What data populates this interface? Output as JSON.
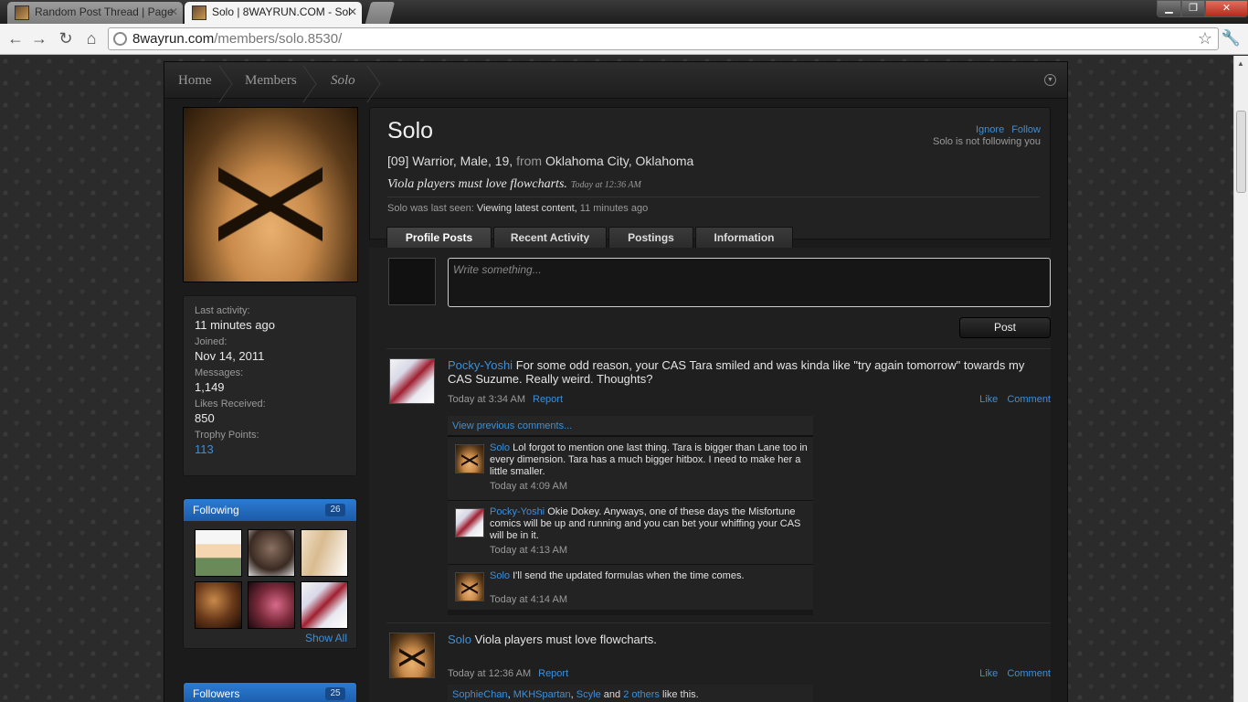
{
  "browser": {
    "tabs": [
      {
        "title": "Random Post Thread | Page",
        "active": false
      },
      {
        "title": "Solo | 8WAYRUN.COM - Sol",
        "active": true
      }
    ],
    "url_host": "8wayrun.com",
    "url_path": "/members/solo.8530/"
  },
  "breadcrumb": [
    "Home",
    "Members",
    "Solo"
  ],
  "sidebar": {
    "stats": [
      {
        "label": "Last activity:",
        "value": "11 minutes ago"
      },
      {
        "label": "Joined:",
        "value": "Nov 14, 2011"
      },
      {
        "label": "Messages:",
        "value": "1,149"
      },
      {
        "label": "Likes Received:",
        "value": "850"
      },
      {
        "label": "Trophy Points:",
        "value": "113"
      }
    ],
    "following": {
      "title": "Following",
      "count": "26",
      "show_all": "Show All"
    },
    "followers": {
      "title": "Followers",
      "count": "25"
    }
  },
  "profile": {
    "username": "Solo",
    "meta_prefix": "[09] Warrior, Male, 19, ",
    "meta_from": "from",
    "meta_location": "Oklahoma City, Oklahoma",
    "status": "Viola players must love flowcharts.",
    "status_time": "Today at 12:36 AM",
    "last_seen_prefix": "Solo was last seen:",
    "last_seen_what": "Viewing latest content,",
    "last_seen_when": "11 minutes ago",
    "ignore": "Ignore",
    "follow": "Follow",
    "follow_status": "Solo is not following you"
  },
  "tabs": [
    {
      "label": "Profile Posts",
      "active": true
    },
    {
      "label": "Recent Activity",
      "active": false
    },
    {
      "label": "Postings",
      "active": false
    },
    {
      "label": "Information",
      "active": false
    }
  ],
  "write": {
    "placeholder": "Write something...",
    "post_button": "Post"
  },
  "posts": [
    {
      "author": "Pocky-Yoshi",
      "text": "For some odd reason, your CAS Tara smiled and was kinda like \"try again tomorrow\" towards my CAS Suzume. Really weird. Thoughts?",
      "time": "Today at 3:34 AM",
      "report": "Report",
      "like": "Like",
      "comment": "Comment",
      "view_previous": "View previous comments...",
      "comments": [
        {
          "author": "Solo",
          "text": "Lol forgot to mention one last thing. Tara is bigger than Lane too in every dimension. Tara has a much bigger hitbox. I need to make her a little smaller.",
          "time": "Today at 4:09 AM"
        },
        {
          "author": "Pocky-Yoshi",
          "text": "Okie Dokey. Anyways, one of these days the Misfortune comics will be up and running and you can bet your whiffing your CAS will be in it.",
          "time": "Today at 4:13 AM"
        },
        {
          "author": "Solo",
          "text": "I'll send the updated formulas when the time comes.",
          "time": "Today at 4:14 AM"
        }
      ]
    },
    {
      "author": "Solo",
      "text": "Viola players must love flowcharts.",
      "time": "Today at 12:36 AM",
      "report": "Report",
      "like": "Like",
      "comment": "Comment",
      "likers": [
        "SophieChan",
        "MKHSpartan",
        "Scyle"
      ],
      "others": "2 others",
      "and": "and",
      "likes_suffix": "like this."
    }
  ]
}
